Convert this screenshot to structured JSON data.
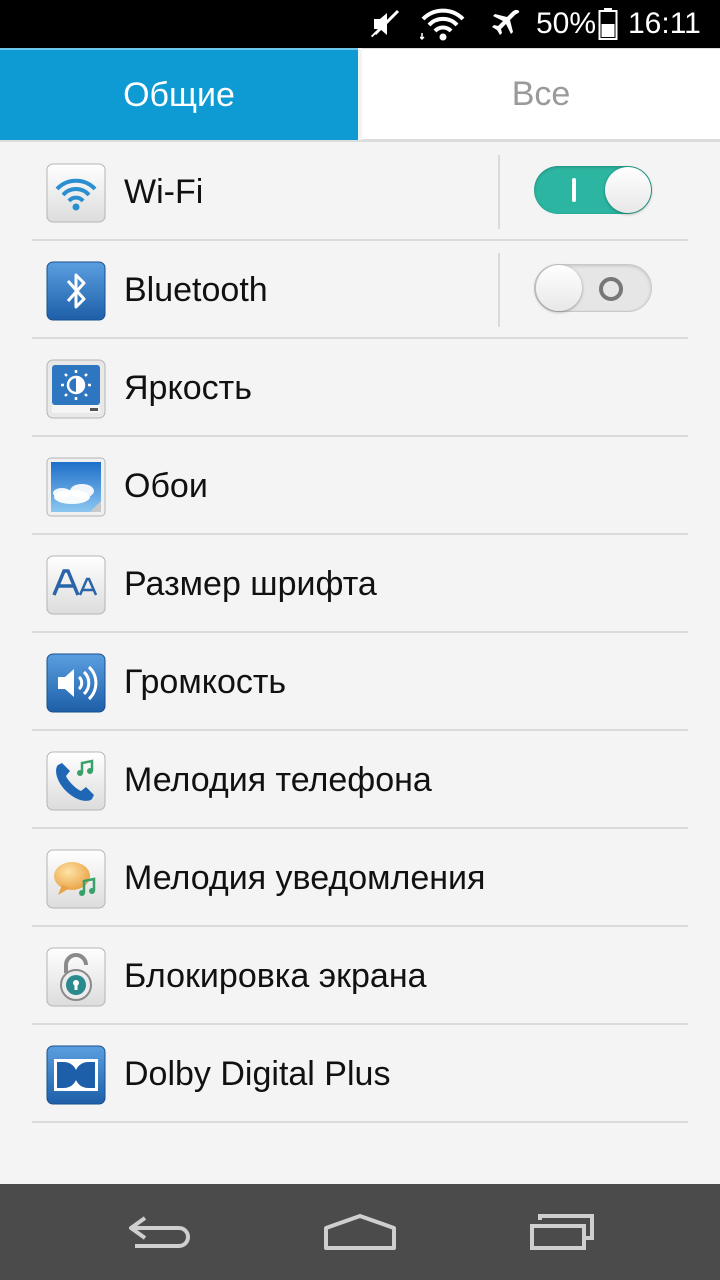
{
  "status_bar": {
    "battery_text": "50%",
    "battery_level": 0.5,
    "time": "16:11",
    "icons": [
      "mute-icon",
      "wifi-icon",
      "airplane-mode-icon",
      "battery-icon"
    ]
  },
  "tabs": {
    "general": "Общие",
    "all": "Все",
    "active": "general"
  },
  "settings": [
    {
      "label": "Wi-Fi",
      "icon": "wifi-settings-icon",
      "toggle": true
    },
    {
      "label": "Bluetooth",
      "icon": "bluetooth-icon",
      "toggle": false
    },
    {
      "label": "Яркость",
      "icon": "brightness-icon"
    },
    {
      "label": "Обои",
      "icon": "wallpaper-icon"
    },
    {
      "label": "Размер шрифта",
      "icon": "font-size-icon"
    },
    {
      "label": "Громкость",
      "icon": "volume-icon"
    },
    {
      "label": "Мелодия телефона",
      "icon": "ringtone-icon"
    },
    {
      "label": "Мелодия уведомления",
      "icon": "notification-sound-icon"
    },
    {
      "label": "Блокировка экрана",
      "icon": "screen-lock-icon"
    },
    {
      "label": "Dolby Digital Plus",
      "icon": "dolby-icon"
    }
  ],
  "nav_bar": {
    "buttons": [
      "back-icon",
      "home-icon",
      "recent-apps-icon"
    ]
  },
  "colors": {
    "accent": "#0e9ad2",
    "toggle_on": "#2cb6a2",
    "nav_bar": "#4b4b4b",
    "status_bar": "#000000"
  }
}
